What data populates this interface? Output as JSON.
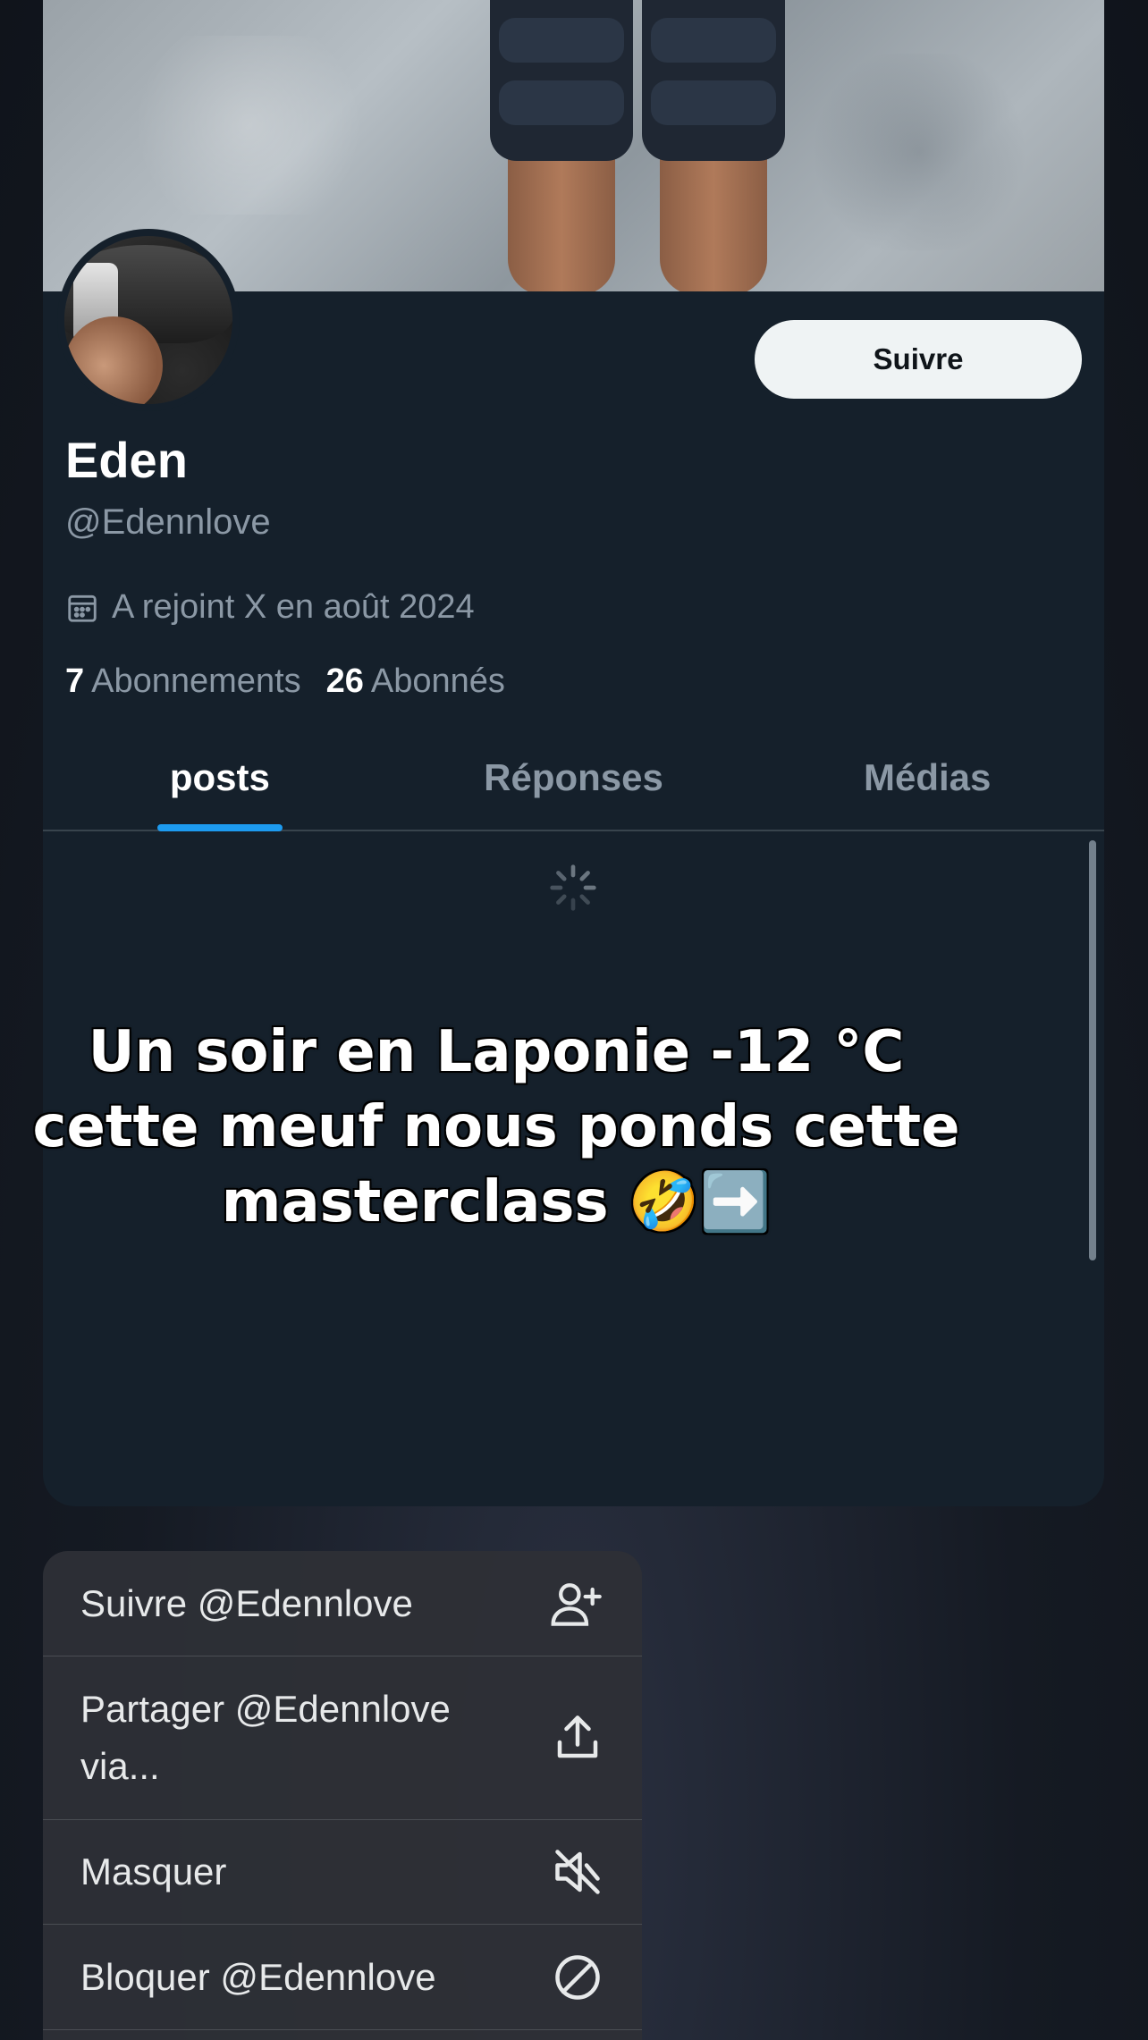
{
  "profile": {
    "name": "Eden",
    "handle": "@Edennlove",
    "joined": "A rejoint X en août 2024",
    "follow_label": "Suivre",
    "following_count": "7",
    "following_label": "Abonnements",
    "followers_count": "26",
    "followers_label": "Abonnés"
  },
  "tabs": [
    {
      "label": "posts",
      "active": true
    },
    {
      "label": "Réponses",
      "active": false
    },
    {
      "label": "Médias",
      "active": false
    }
  ],
  "overlay_caption": "Un soir en Laponie -12 °C cette meuf nous ponds cette masterclass 🤣➡️",
  "menu": {
    "items": [
      {
        "label": "Suivre @Edennlove",
        "icon": "add-user-icon"
      },
      {
        "label": "Partager @Edennlove via...",
        "icon": "share-icon"
      },
      {
        "label": "Masquer",
        "icon": "mute-icon"
      },
      {
        "label": "Bloquer @Edennlove",
        "icon": "block-icon"
      }
    ]
  },
  "colors": {
    "background": "#15202b",
    "accent": "#1d9bf0",
    "follow_button": "#eff3f4",
    "secondary_text": "#8b98a5"
  }
}
